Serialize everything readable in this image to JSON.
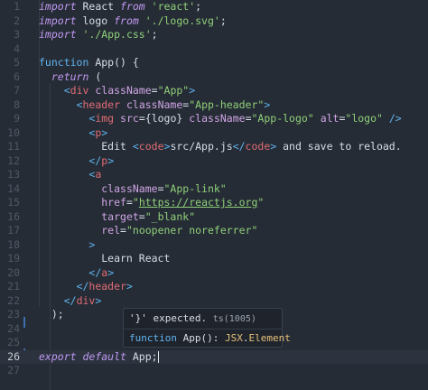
{
  "editor": {
    "line_numbers": [
      "1",
      "2",
      "3",
      "4",
      "5",
      "6",
      "7",
      "8",
      "9",
      "10",
      "11",
      "12",
      "13",
      "14",
      "15",
      "16",
      "17",
      "18",
      "19",
      "20",
      "21",
      "22",
      "23",
      "24",
      "25",
      "26",
      "27"
    ],
    "current_line": "26",
    "lines": [
      [
        {
          "t": "import",
          "c": "kw"
        },
        {
          "t": " React ",
          "c": "pl"
        },
        {
          "t": "from",
          "c": "kw"
        },
        {
          "t": " ",
          "c": "pl"
        },
        {
          "t": "'react'",
          "c": "str"
        },
        {
          "t": ";",
          "c": "pl"
        }
      ],
      [
        {
          "t": "import",
          "c": "kw"
        },
        {
          "t": " logo ",
          "c": "pl"
        },
        {
          "t": "from",
          "c": "kw"
        },
        {
          "t": " ",
          "c": "pl"
        },
        {
          "t": "'./logo.svg'",
          "c": "str"
        },
        {
          "t": ";",
          "c": "pl"
        }
      ],
      [
        {
          "t": "import",
          "c": "kw"
        },
        {
          "t": " ",
          "c": "pl"
        },
        {
          "t": "'./App.css'",
          "c": "str"
        },
        {
          "t": ";",
          "c": "pl"
        }
      ],
      [],
      [
        {
          "t": "function",
          "c": "fn"
        },
        {
          "t": " App() {",
          "c": "pl"
        }
      ],
      [
        {
          "t": "  ",
          "c": "pl"
        },
        {
          "t": "return",
          "c": "kw"
        },
        {
          "t": " (",
          "c": "pl"
        }
      ],
      [
        {
          "t": "    ",
          "c": "pl"
        },
        {
          "t": "<",
          "c": "brk"
        },
        {
          "t": "div",
          "c": "tag"
        },
        {
          "t": " ",
          "c": "pl"
        },
        {
          "t": "className",
          "c": "attr"
        },
        {
          "t": "=",
          "c": "pl"
        },
        {
          "t": "\"App\"",
          "c": "str"
        },
        {
          "t": ">",
          "c": "brk"
        }
      ],
      [
        {
          "t": "      ",
          "c": "pl"
        },
        {
          "t": "<",
          "c": "brk"
        },
        {
          "t": "header",
          "c": "tag"
        },
        {
          "t": " ",
          "c": "pl"
        },
        {
          "t": "className",
          "c": "attr"
        },
        {
          "t": "=",
          "c": "pl"
        },
        {
          "t": "\"App-header\"",
          "c": "str"
        },
        {
          "t": ">",
          "c": "brk"
        }
      ],
      [
        {
          "t": "        ",
          "c": "pl"
        },
        {
          "t": "<",
          "c": "brk"
        },
        {
          "t": "img",
          "c": "tag"
        },
        {
          "t": " ",
          "c": "pl"
        },
        {
          "t": "src",
          "c": "attr"
        },
        {
          "t": "=",
          "c": "pl"
        },
        {
          "t": "{logo}",
          "c": "pl"
        },
        {
          "t": " ",
          "c": "pl"
        },
        {
          "t": "className",
          "c": "attr"
        },
        {
          "t": "=",
          "c": "pl"
        },
        {
          "t": "\"App-logo\"",
          "c": "str"
        },
        {
          "t": " ",
          "c": "pl"
        },
        {
          "t": "alt",
          "c": "attr"
        },
        {
          "t": "=",
          "c": "pl"
        },
        {
          "t": "\"logo\"",
          "c": "str"
        },
        {
          "t": " />",
          "c": "brk"
        }
      ],
      [
        {
          "t": "        ",
          "c": "pl"
        },
        {
          "t": "<",
          "c": "brk"
        },
        {
          "t": "p",
          "c": "tag"
        },
        {
          "t": ">",
          "c": "brk"
        }
      ],
      [
        {
          "t": "          Edit ",
          "c": "pl"
        },
        {
          "t": "<",
          "c": "brk"
        },
        {
          "t": "code",
          "c": "tag"
        },
        {
          "t": ">",
          "c": "brk"
        },
        {
          "t": "src/App.js",
          "c": "pl"
        },
        {
          "t": "</",
          "c": "brk"
        },
        {
          "t": "code",
          "c": "tag"
        },
        {
          "t": ">",
          "c": "brk"
        },
        {
          "t": " and save to reload.",
          "c": "pl"
        }
      ],
      [
        {
          "t": "        ",
          "c": "pl"
        },
        {
          "t": "</",
          "c": "brk"
        },
        {
          "t": "p",
          "c": "tag"
        },
        {
          "t": ">",
          "c": "brk"
        }
      ],
      [
        {
          "t": "        ",
          "c": "pl"
        },
        {
          "t": "<",
          "c": "brk"
        },
        {
          "t": "a",
          "c": "tag"
        }
      ],
      [
        {
          "t": "          ",
          "c": "pl"
        },
        {
          "t": "className",
          "c": "attr"
        },
        {
          "t": "=",
          "c": "pl"
        },
        {
          "t": "\"App-link\"",
          "c": "str"
        }
      ],
      [
        {
          "t": "          ",
          "c": "pl"
        },
        {
          "t": "href",
          "c": "attr"
        },
        {
          "t": "=",
          "c": "pl"
        },
        {
          "t": "\"",
          "c": "str"
        },
        {
          "t": "https://reactjs.org",
          "c": "url"
        },
        {
          "t": "\"",
          "c": "str"
        }
      ],
      [
        {
          "t": "          ",
          "c": "pl"
        },
        {
          "t": "target",
          "c": "attr"
        },
        {
          "t": "=",
          "c": "pl"
        },
        {
          "t": "\"_blank\"",
          "c": "str"
        }
      ],
      [
        {
          "t": "          ",
          "c": "pl"
        },
        {
          "t": "rel",
          "c": "attr"
        },
        {
          "t": "=",
          "c": "pl"
        },
        {
          "t": "\"noopener noreferrer\"",
          "c": "str"
        }
      ],
      [
        {
          "t": "        ",
          "c": "pl"
        },
        {
          "t": ">",
          "c": "brk"
        }
      ],
      [
        {
          "t": "          Learn React",
          "c": "pl"
        }
      ],
      [
        {
          "t": "        ",
          "c": "pl"
        },
        {
          "t": "</",
          "c": "brk"
        },
        {
          "t": "a",
          "c": "tag"
        },
        {
          "t": ">",
          "c": "brk"
        }
      ],
      [
        {
          "t": "      ",
          "c": "pl"
        },
        {
          "t": "</",
          "c": "brk"
        },
        {
          "t": "header",
          "c": "tag"
        },
        {
          "t": ">",
          "c": "brk"
        }
      ],
      [
        {
          "t": "    ",
          "c": "pl"
        },
        {
          "t": "</",
          "c": "brk"
        },
        {
          "t": "div",
          "c": "tag"
        },
        {
          "t": ">",
          "c": "brk"
        }
      ],
      [
        {
          "t": "  );",
          "c": "pl"
        }
      ],
      [],
      [],
      [
        {
          "t": "export",
          "c": "kw"
        },
        {
          "t": " ",
          "c": "pl"
        },
        {
          "t": "default",
          "c": "kw"
        },
        {
          "t": " App;",
          "c": "pl"
        }
      ],
      []
    ]
  },
  "tooltip": {
    "message": "'}' expected.",
    "code": "ts(1005)",
    "signature_keyword": "function",
    "signature_name": " App(): ",
    "signature_type_ns": "JSX",
    "signature_dot": ".",
    "signature_type": "Element"
  },
  "colors": {
    "background": "#262c35",
    "active_line": "#2c333e",
    "keyword": "#c099f2",
    "function": "#5fb3f0",
    "string": "#8fd07a",
    "tag": "#e06c75",
    "attribute": "#cfa5e6"
  }
}
